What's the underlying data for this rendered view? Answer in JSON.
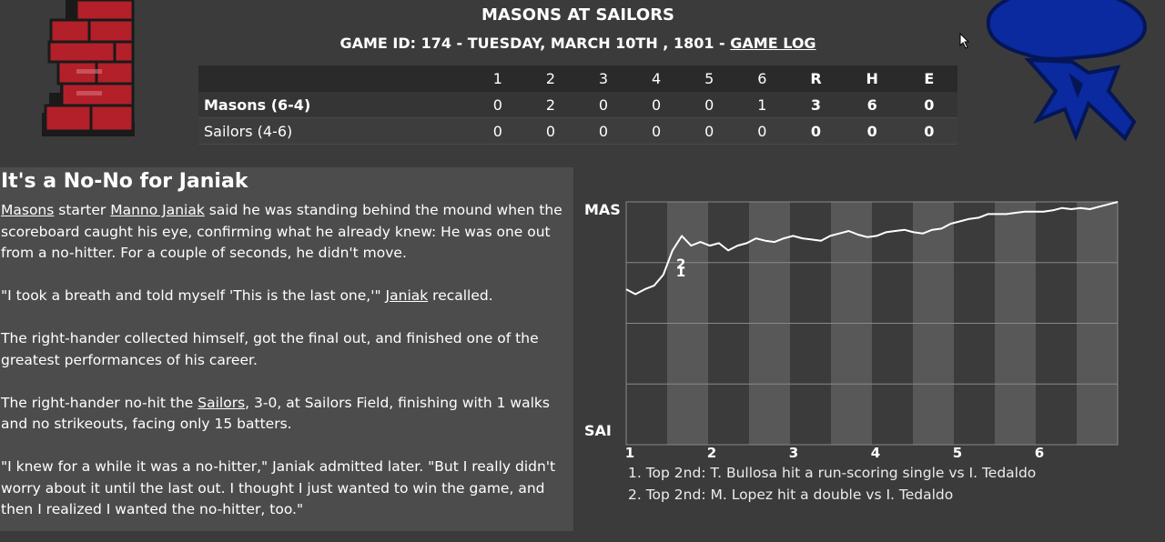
{
  "header": {
    "matchup": "MASONS AT SAILORS",
    "game_info": "GAME ID: 174 - TUESDAY, MARCH 10TH , 1801 - ",
    "game_log_link": "GAME LOG"
  },
  "scoreboard": {
    "columns": [
      "1",
      "2",
      "3",
      "4",
      "5",
      "6",
      "R",
      "H",
      "E"
    ],
    "rows": [
      {
        "team": "Masons (6-4)",
        "innings": [
          "0",
          "2",
          "0",
          "0",
          "0",
          "1"
        ],
        "R": "3",
        "H": "6",
        "E": "0"
      },
      {
        "team": "Sailors (4-6)",
        "innings": [
          "0",
          "0",
          "0",
          "0",
          "0",
          "0"
        ],
        "R": "0",
        "H": "0",
        "E": "0"
      }
    ]
  },
  "story": {
    "headline": "It's a No-No for Janiak",
    "p1": {
      "team_link": "Masons",
      "t1": " starter ",
      "player_link": "Manno Janiak",
      "t2": " said he was standing behind the mound when the scoreboard caught his eye, confirming what he already knew: He was one out from a no-hitter. For a couple of seconds, he didn't move."
    },
    "p2": {
      "t1": "\"I took a breath and told myself 'This is the last one,'\" ",
      "player_link": "Janiak",
      "t2": " recalled."
    },
    "p3": "The right-hander collected himself, got the final out, and finished one of the greatest performances of his career.",
    "p4": {
      "t1": "The right-hander no-hit the ",
      "team_link": "Sailors",
      "t2": ", 3-0, at Sailors Field, finishing with 1 walks and no strikeouts, facing only 15 batters."
    },
    "p5": "\"I knew for a while it was a no-hitter,\" Janiak admitted later. \"But I really didn't worry about it until the last out. I thought I just wanted to win the game, and then I realized I wanted the no-hitter, too.\""
  },
  "chart_data": {
    "type": "line",
    "top_label": "MAS",
    "bottom_label": "SAI",
    "inning_labels": [
      "1",
      "2",
      "3",
      "4",
      "5",
      "6"
    ],
    "ylim": [
      0,
      1
    ],
    "series": [
      {
        "values": [
          0.64,
          0.62,
          0.64,
          0.655,
          0.7,
          0.8,
          0.86,
          0.82,
          0.835,
          0.82,
          0.83,
          0.8,
          0.82,
          0.83,
          0.85,
          0.84,
          0.835,
          0.85,
          0.86,
          0.85,
          0.845,
          0.84,
          0.86,
          0.87,
          0.88,
          0.865,
          0.855,
          0.86,
          0.875,
          0.88,
          0.885,
          0.875,
          0.87,
          0.885,
          0.89,
          0.91,
          0.92,
          0.93,
          0.935,
          0.95,
          0.95,
          0.95,
          0.955,
          0.96,
          0.96,
          0.96,
          0.965,
          0.975,
          0.97,
          0.975,
          0.97,
          0.98,
          0.99,
          1.0
        ]
      }
    ],
    "annotations": [
      {
        "label": "1",
        "text": "1. Top 2nd: T. Bullosa hit a run-scoring single vs I. Tedaldo"
      },
      {
        "label": "2",
        "text": "2. Top 2nd: M. Lopez hit a double vs I. Tedaldo"
      }
    ],
    "colors": {
      "line": "#ffffff",
      "band": "#585858",
      "grid": "#8a8a8a"
    }
  }
}
